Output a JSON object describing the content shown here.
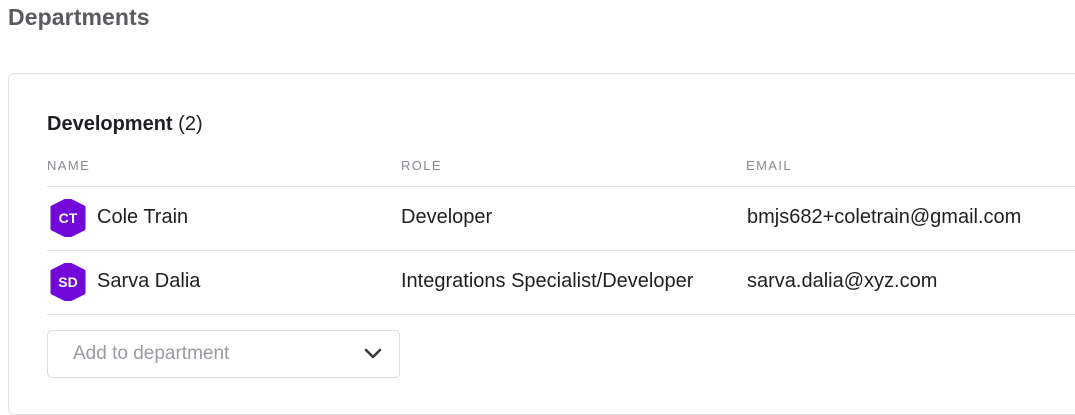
{
  "page": {
    "title": "Departments"
  },
  "department": {
    "name": "Development",
    "count": "(2)",
    "columns": {
      "name": "NAME",
      "role": "ROLE",
      "email": "EMAIL"
    },
    "members": [
      {
        "initials": "CT",
        "name": "Cole Train",
        "role": "Developer",
        "email": "bmjs682+coletrain@gmail.com"
      },
      {
        "initials": "SD",
        "name": "Sarva Dalia",
        "role": "Integrations Specialist/Developer",
        "email": "sarva.dalia@xyz.com"
      }
    ],
    "add_placeholder": "Add to department"
  },
  "colors": {
    "avatar": "#7209d9",
    "title": "#5a5a5f",
    "border": "#e4e4e7",
    "muted": "#8a8a90"
  },
  "icons": {
    "avatar_shape": "hexagon",
    "dropdown": "chevron-down-icon"
  }
}
